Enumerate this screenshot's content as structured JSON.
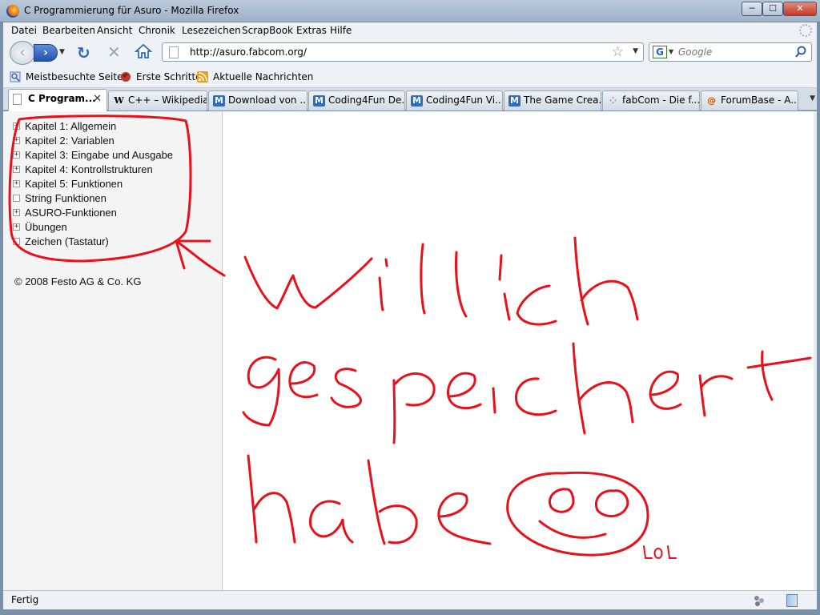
{
  "window": {
    "title": "C Programmierung für Asuro - Mozilla Firefox",
    "min_label": "─",
    "max_label": "☐",
    "close_label": "✕"
  },
  "menu": [
    "Datei",
    "Bearbeiten",
    "Ansicht",
    "Chronik",
    "Lesezeichen",
    "ScrapBook",
    "Extras",
    "Hilfe"
  ],
  "nav": {
    "url": "http://asuro.fabcom.org/",
    "search_placeholder": "Google",
    "back_icon": "back-arrow-icon",
    "forward_icon": "forward-arrow-icon",
    "reload_icon": "reload-icon",
    "stop_icon": "stop-icon",
    "home_icon": "home-icon"
  },
  "bookmarks": [
    "Meistbesuchte Seiten",
    "Erste Schritte",
    "Aktuelle Nachrichten"
  ],
  "tabs": [
    {
      "label": "C Program...",
      "icon": "page"
    },
    {
      "label": "C++ – Wikipedia",
      "icon": "W"
    },
    {
      "label": "Download von ...",
      "icon": "M"
    },
    {
      "label": "Coding4Fun De...",
      "icon": "M"
    },
    {
      "label": "Coding4Fun Vi...",
      "icon": "M"
    },
    {
      "label": "The Game Crea...",
      "icon": "M"
    },
    {
      "label": "fabCom - Die f...",
      "icon": "dots"
    },
    {
      "label": "ForumBase - A...",
      "icon": "swirl"
    }
  ],
  "sidebar": {
    "items": [
      {
        "label": "Kapitel 1: Allgemein",
        "expand": "+"
      },
      {
        "label": "Kapitel 2: Variablen",
        "expand": "+"
      },
      {
        "label": "Kapitel 3: Eingabe und Ausgabe",
        "expand": "+"
      },
      {
        "label": "Kapitel 4: Kontrollstrukturen",
        "expand": "+"
      },
      {
        "label": "Kapitel 5: Funktionen",
        "expand": "+"
      },
      {
        "label": "String Funktionen",
        "expand": ""
      },
      {
        "label": "ASURO-Funktionen",
        "expand": "+"
      },
      {
        "label": "Übungen",
        "expand": "+"
      },
      {
        "label": "Zeichen (Tastatur)",
        "expand": ""
      }
    ],
    "copyright": "© 2008 Festo AG & Co. KG"
  },
  "annotation": {
    "color": "#e8101a",
    "text_line_1": "willich",
    "text_line_2": "gespeichert",
    "text_line_3": "habe",
    "small_text": "LOL"
  },
  "status": {
    "text": "Fertig"
  }
}
